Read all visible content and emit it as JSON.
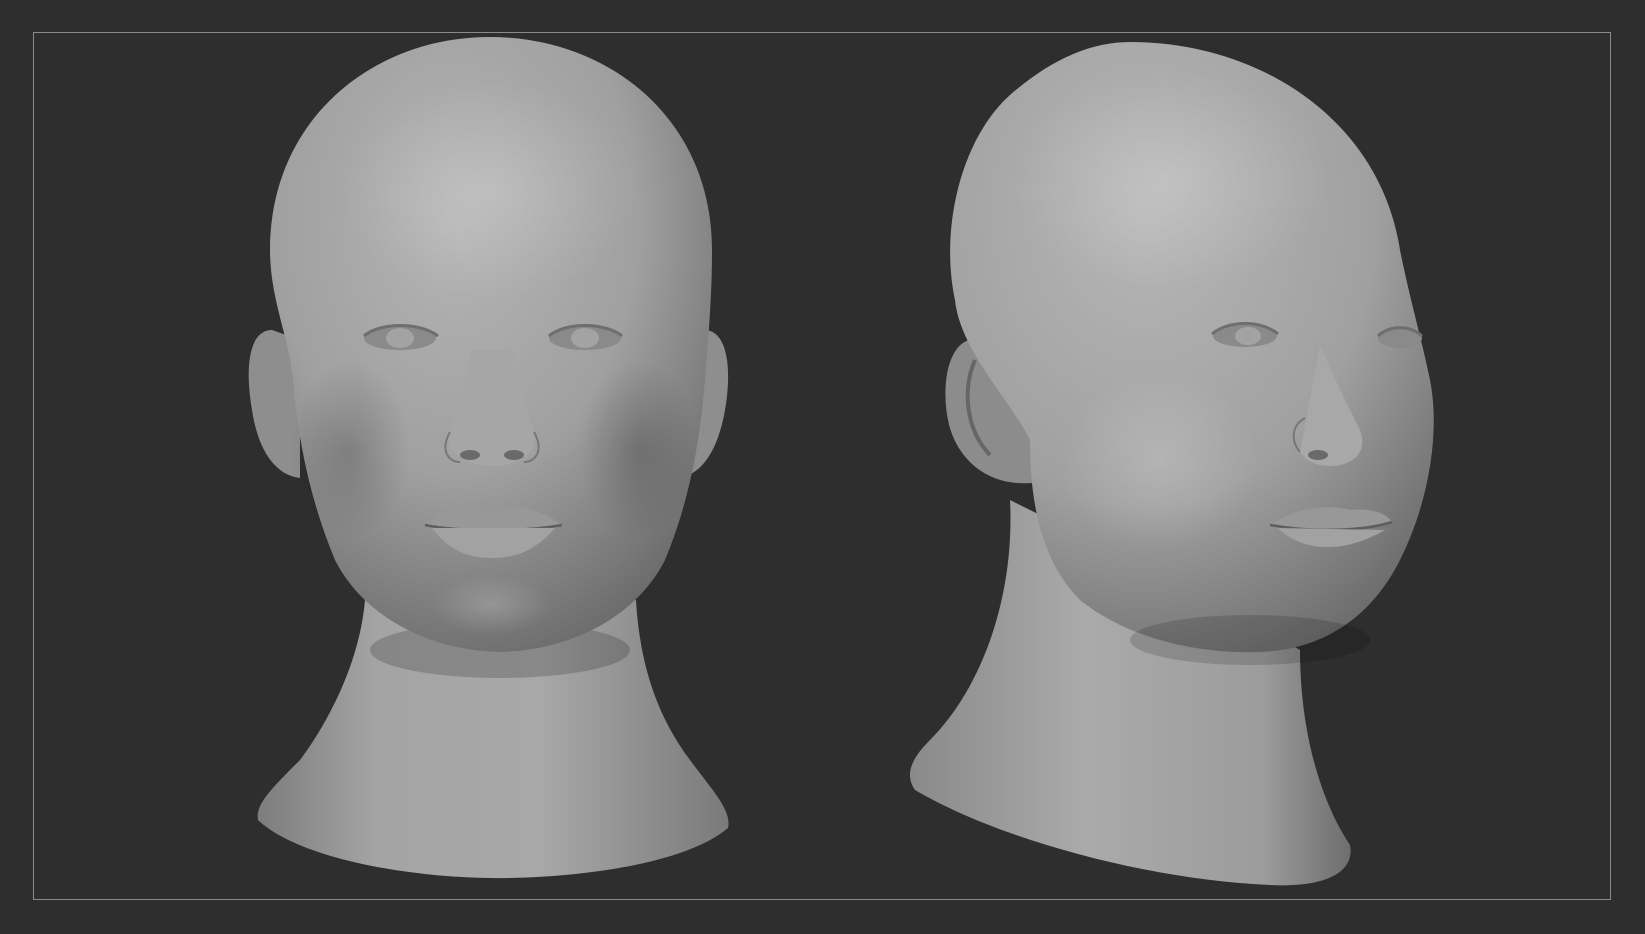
{
  "viewport": {
    "background_color": "#2e2e2e",
    "frame_color": "#8a8a8a",
    "material_color": "#9a9a9a"
  },
  "models": [
    {
      "view": "front",
      "icon": "sculpt-head-front"
    },
    {
      "view": "three-quarter",
      "icon": "sculpt-head-three-quarter"
    }
  ]
}
